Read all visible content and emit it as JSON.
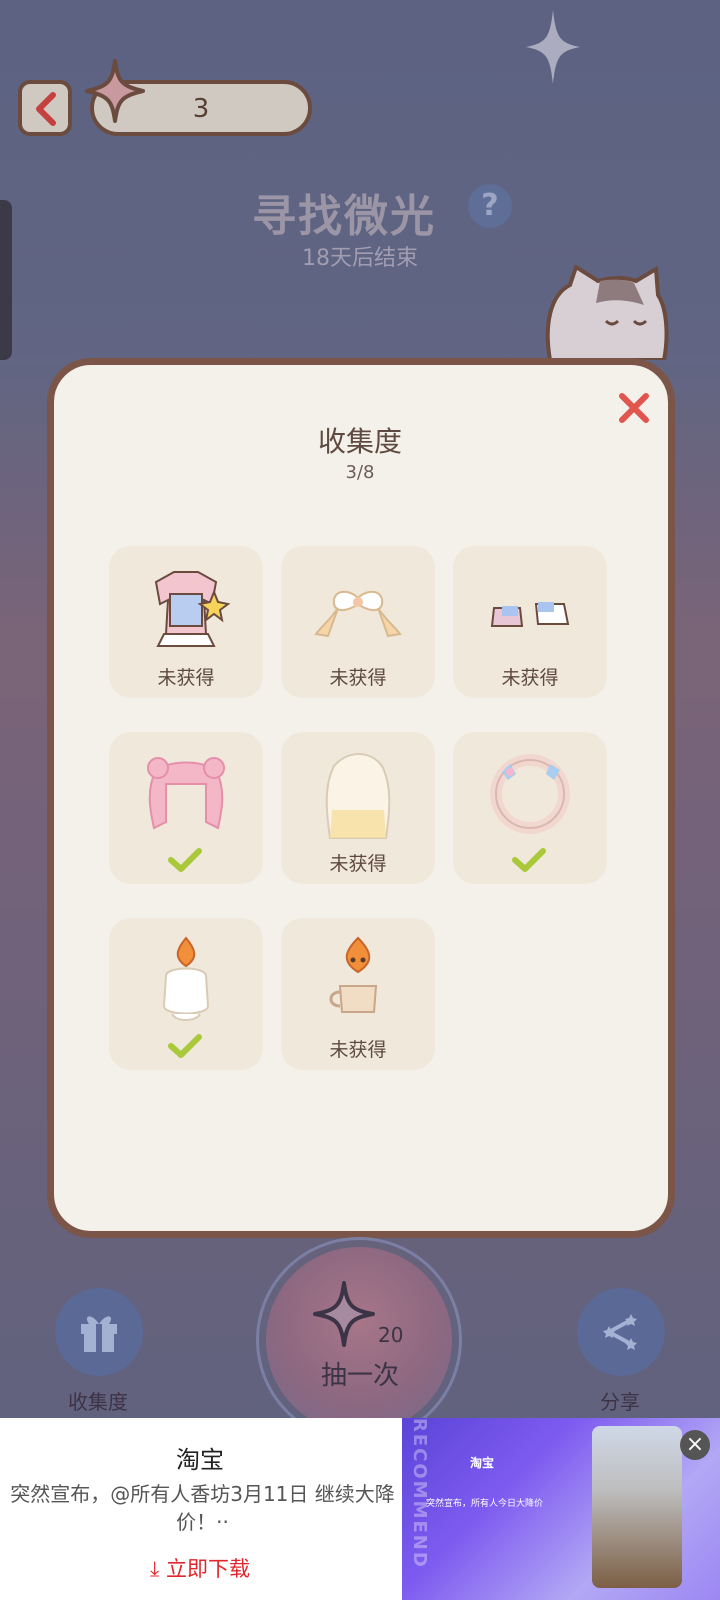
{
  "header": {
    "star_count": "3"
  },
  "event": {
    "title": "寻找微光",
    "subtitle": "18天后结束"
  },
  "modal": {
    "title": "收集度",
    "count": "3/8",
    "items": [
      {
        "label": "未获得",
        "obtained": false,
        "icon": "outfit-dress-icon"
      },
      {
        "label": "未获得",
        "obtained": false,
        "icon": "bow-ribbon-icon"
      },
      {
        "label": "未获得",
        "obtained": false,
        "icon": "shoes-icon"
      },
      {
        "label": "",
        "obtained": true,
        "icon": "pink-hair-icon"
      },
      {
        "label": "未获得",
        "obtained": false,
        "icon": "long-hair-icon"
      },
      {
        "label": "",
        "obtained": true,
        "icon": "flower-wreath-icon"
      },
      {
        "label": "",
        "obtained": true,
        "icon": "candle-icon"
      },
      {
        "label": "未获得",
        "obtained": false,
        "icon": "candle-cup-icon"
      }
    ]
  },
  "actions": {
    "collection_label": "收集度",
    "draw_cost": "20",
    "draw_label": "抽一次",
    "share_label": "分享"
  },
  "ad": {
    "title": "淘宝",
    "text": "突然宣布，@所有人香坊3月11日 继续大降价！··",
    "download": "立即下载",
    "image_vertical_text": "RECOMMEND",
    "image_title": "淘宝",
    "image_subtitle": "突然宣布，所有人今日大降价"
  },
  "colors": {
    "accent": "#6b4b3e",
    "check": "#a9c93a",
    "close": "#e0554e"
  }
}
